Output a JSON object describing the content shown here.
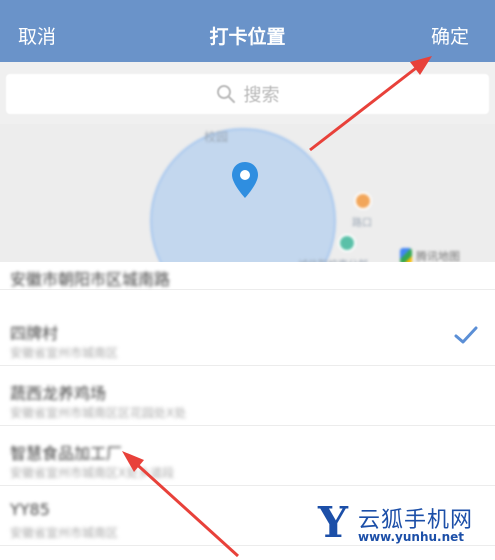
{
  "nav": {
    "cancel_label": "取消",
    "title": "打卡位置",
    "confirm_label": "确定"
  },
  "search": {
    "placeholder": "搜索"
  },
  "map": {
    "label_top": "校园",
    "label_orange": "路口",
    "label_green": "诚信职校南分部",
    "label_logo": "腾讯地图",
    "circle_color": "#a9c8ee",
    "pin_color": "#2f8ee0"
  },
  "list": {
    "items": [
      {
        "title": "安徽市朝阳市区城南路",
        "subtitle": ""
      },
      {
        "title": "四牌村",
        "subtitle": "安徽省宣州市城南区",
        "selected": true
      },
      {
        "title": "蔬西龙养鸡场",
        "subtitle": "安徽省宣州市城南区区花园处X处",
        "selected": false
      },
      {
        "title": "智慧食品加工厂",
        "subtitle": "安徽省宣州市城南区X处乡道段",
        "selected": false
      },
      {
        "title": "YY85",
        "subtitle": "安徽省宣州市城南区",
        "selected": false
      }
    ]
  },
  "watermark": {
    "letter": "Y",
    "name": "云狐手机网",
    "url": "www.yunhu.net"
  },
  "colors": {
    "navbar": "#6a93c9",
    "arrow": "#e8413a",
    "check": "#5b8fd6",
    "watermark": "#1c4fa8"
  }
}
